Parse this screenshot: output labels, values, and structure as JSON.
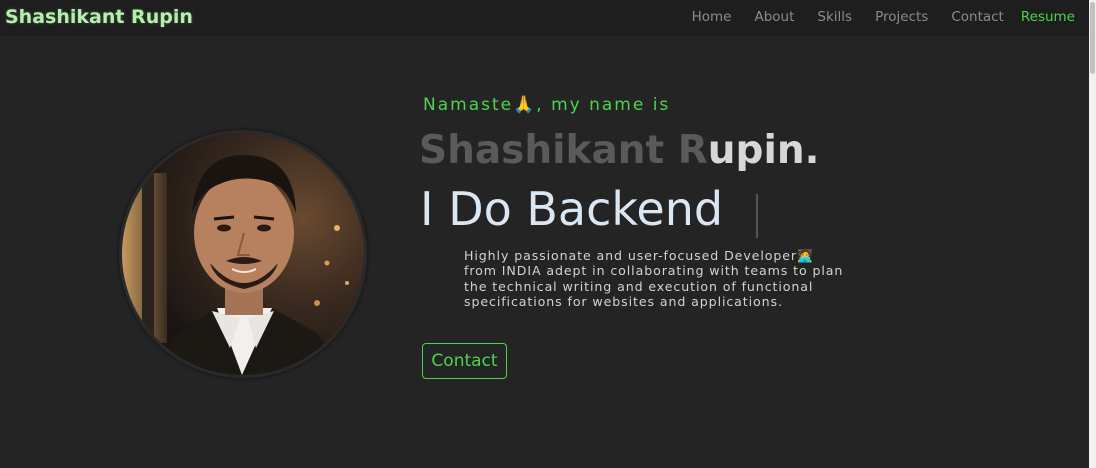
{
  "nav": {
    "brand": "Shashikant Rupin",
    "links": [
      "Home",
      "About",
      "Skills",
      "Projects",
      "Contact"
    ],
    "resume": "Resume"
  },
  "hero": {
    "greeting": "Namaste🙏, my name is",
    "name_dim": "Shashikant R",
    "name_lit": "upin.",
    "tagline": "I Do Backend",
    "description": "Highly passionate and user-focused Developer🧑‍💻 from INDIA adept in collaborating with teams to plan the technical writing and execution of functional specifications for websites and applications.",
    "contact_button": "Contact"
  },
  "colors": {
    "accent": "#4cd44c",
    "background": "#242424",
    "navbar": "#1e1e1e"
  }
}
